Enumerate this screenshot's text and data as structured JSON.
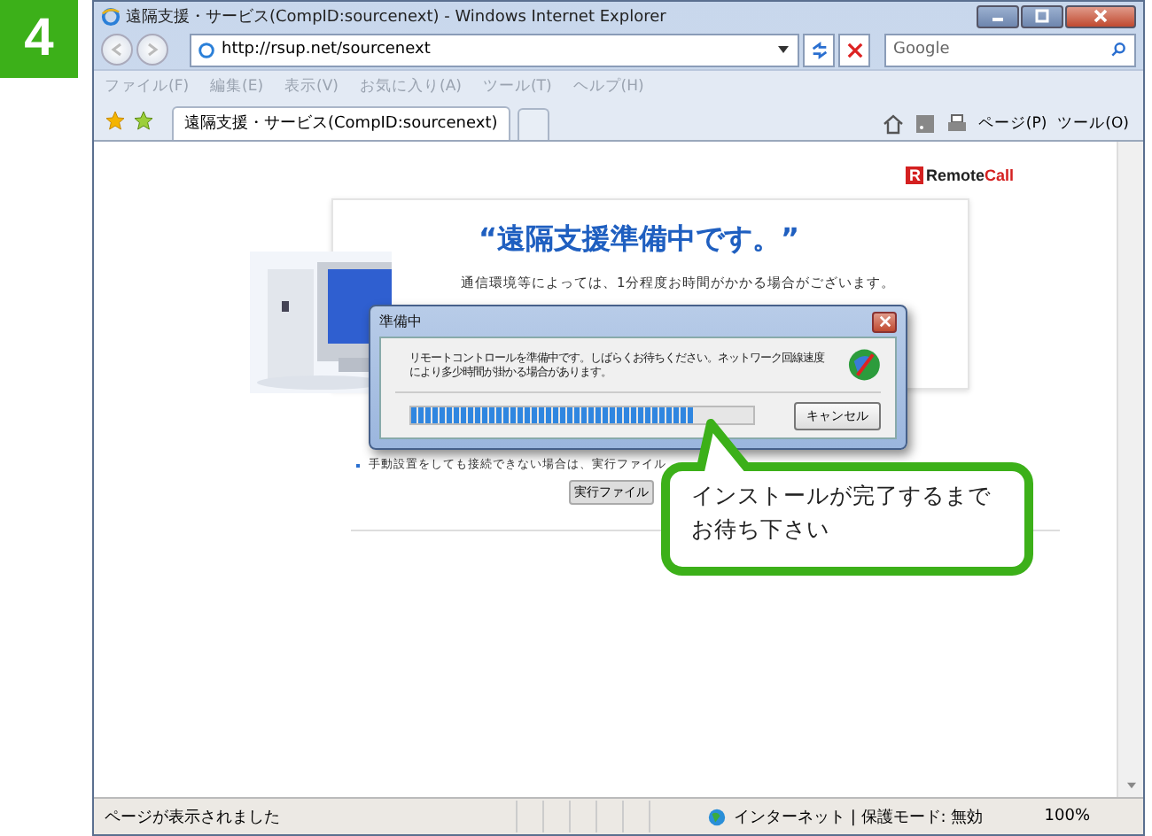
{
  "step": {
    "number": "4"
  },
  "window": {
    "title": "遠隔支援・サービス(CompID:sourcenext) - Windows Internet Explorer"
  },
  "address_bar": {
    "url": "http://rsup.net/sourcenext"
  },
  "search": {
    "placeholder": "Google"
  },
  "menu": [
    {
      "label": "ファイル(F)",
      "disabled": true
    },
    {
      "label": "編集(E)",
      "disabled": true
    },
    {
      "label": "表示(V)",
      "disabled": true
    },
    {
      "label": "お気に入り(A)",
      "disabled": true
    },
    {
      "label": "ツール(T)",
      "disabled": true
    },
    {
      "label": "ヘルプ(H)",
      "disabled": true
    }
  ],
  "tabs": [
    {
      "label": "遠隔支援・サービス(CompID:sourcenext)",
      "selected": true
    }
  ],
  "command_bar": [
    {
      "kind": "home"
    },
    {
      "kind": "feed"
    },
    {
      "kind": "print"
    },
    {
      "kind": "text",
      "label": "ページ(P)"
    },
    {
      "kind": "text",
      "label": "ツール(O)"
    }
  ],
  "page": {
    "logo": {
      "mark": "R",
      "name": "Remote",
      "accent": "Call"
    },
    "heading": "“遠隔支援準備中です。”",
    "lines": [
      "通信環境等によっては、1分程度お時間がかかる場合がございます。"
    ],
    "note": "手動設置をしても接続できない場合は、実行ファイル",
    "note_button": "実行ファイル"
  },
  "dialog": {
    "title": "準備中",
    "message": "リモートコントロールを準備中です。しばらくお待ちください。ネットワーク回線速度により多少時間が掛かる場合があります。",
    "progress": {
      "level": 0.83
    },
    "button": "キャンセル"
  },
  "callout": {
    "lines": [
      "インストールが完了するまで",
      "お待ち下さい"
    ]
  },
  "status_bar": {
    "text": "ページが表示されました",
    "zone": "インターネット | 保護モード: 無効",
    "zoom": "100%"
  }
}
